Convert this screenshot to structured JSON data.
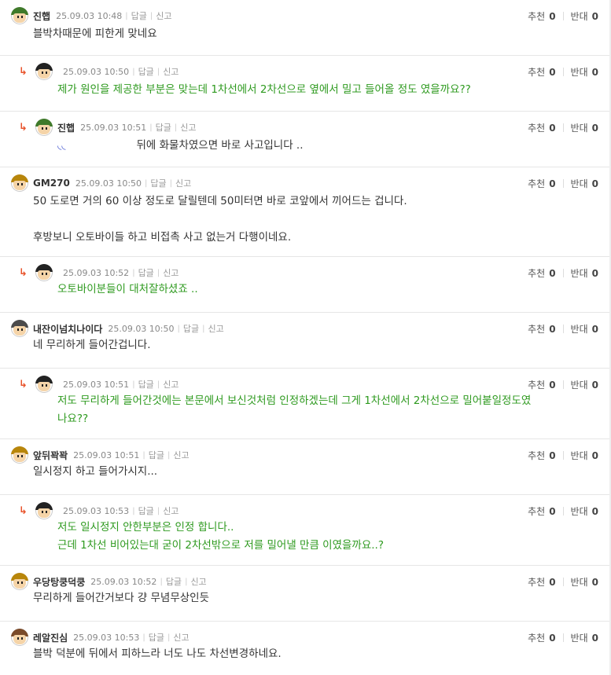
{
  "labels": {
    "reply": "답글",
    "report": "신고",
    "up": "추천",
    "down": "반대"
  },
  "comments": [
    {
      "nick": "진햅",
      "date": "25.09.03 10:48",
      "body": "블박차때문에 피한게 맞네요",
      "up": "0",
      "down": "0"
    },
    {
      "nick": "",
      "date": "25.09.03 10:50",
      "body": "제가 원인을 제공한 부분은 맞는데 1차선에서 2차선으로 옆에서 밀고 들어올 정도 였을까요??",
      "up": "0",
      "down": "0"
    },
    {
      "nick": "진햅",
      "date": "25.09.03 10:51",
      "body": "뒤에 화물차였으면 바로 사고입니다 ..",
      "up": "0",
      "down": "0"
    },
    {
      "nick": "GM270",
      "date": "25.09.03 10:50",
      "body": "50 도로면 거의 60 이상 정도로 달릴텐데 50미터면 바로 코앞에서 끼어드는 겁니다.\n\n후방보니 오토바이들 하고 비접촉 사고 없는거 다행이네요.",
      "up": "0",
      "down": "0"
    },
    {
      "nick": "",
      "date": "25.09.03 10:52",
      "body": "오토바이분들이 대처잘하셨죠 ..",
      "up": "0",
      "down": "0"
    },
    {
      "nick": "내잔이넘치나이다",
      "date": "25.09.03 10:50",
      "body": "네 무리하게 들어간겁니다.",
      "up": "0",
      "down": "0"
    },
    {
      "nick": "",
      "date": "25.09.03 10:51",
      "body": "저도 무리하게 들어간것에는 본문에서 보신것처럼 인정하겠는데 그게 1차선에서 2차선으로 밀어붙일정도였\n나요??",
      "up": "0",
      "down": "0"
    },
    {
      "nick": "앞뒤꽉꽉",
      "date": "25.09.03 10:51",
      "body": "일시정지 하고 들어가시지...",
      "up": "0",
      "down": "0"
    },
    {
      "nick": "",
      "date": "25.09.03 10:53",
      "body": "저도 일시정지 안한부분은 인정 합니다..\n근데 1차선 비어있는대 굳이 2차선밖으로 저를 밀어낼 만큼 이였을까요..?",
      "up": "0",
      "down": "0"
    },
    {
      "nick": "우당탕쿵덕쿵",
      "date": "25.09.03 10:52",
      "body": "무리하게 들어간거보다 걍 무념무상인듯",
      "up": "0",
      "down": "0"
    },
    {
      "nick": "레알진심",
      "date": "25.09.03 10:53",
      "body": "블박 덕분에 뒤에서 피하느라 너도 나도 차선변경하네요.",
      "up": "0",
      "down": "0"
    }
  ],
  "colors": {
    "accent_reply": "#e8542c",
    "author_text": "#2e9a1f",
    "divider": "#e6e6e6"
  }
}
